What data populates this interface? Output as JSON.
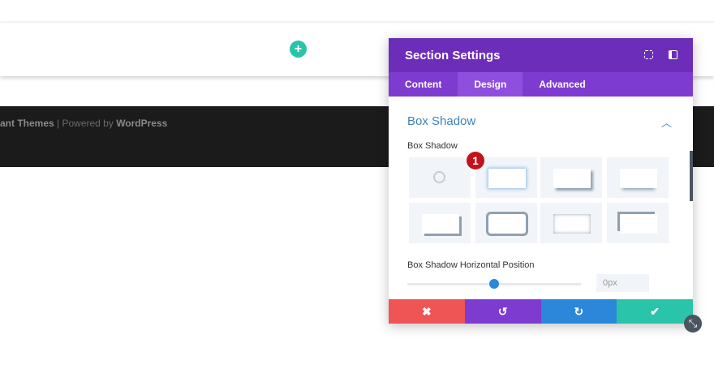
{
  "page": {
    "add_icon": "+",
    "footer_theme": "ant Themes",
    "footer_sep": " | Powered by ",
    "footer_wp": "WordPress"
  },
  "panel": {
    "title": "Section Settings",
    "tabs": [
      {
        "label": "Content"
      },
      {
        "label": "Design"
      },
      {
        "label": "Advanced"
      }
    ],
    "group_title": "Box Shadow",
    "field_label": "Box Shadow",
    "badge": "1",
    "slider_label": "Box Shadow Horizontal Position",
    "slider_value": "0px",
    "slider_fraction": 0.5,
    "buttons": {
      "cancel": "✖",
      "undo": "↺",
      "redo": "↻",
      "save": "✔"
    },
    "colors": {
      "cancel": "#ef5555",
      "undo": "#7e3bd0",
      "redo": "#2b87da",
      "save": "#29c4a9"
    }
  }
}
